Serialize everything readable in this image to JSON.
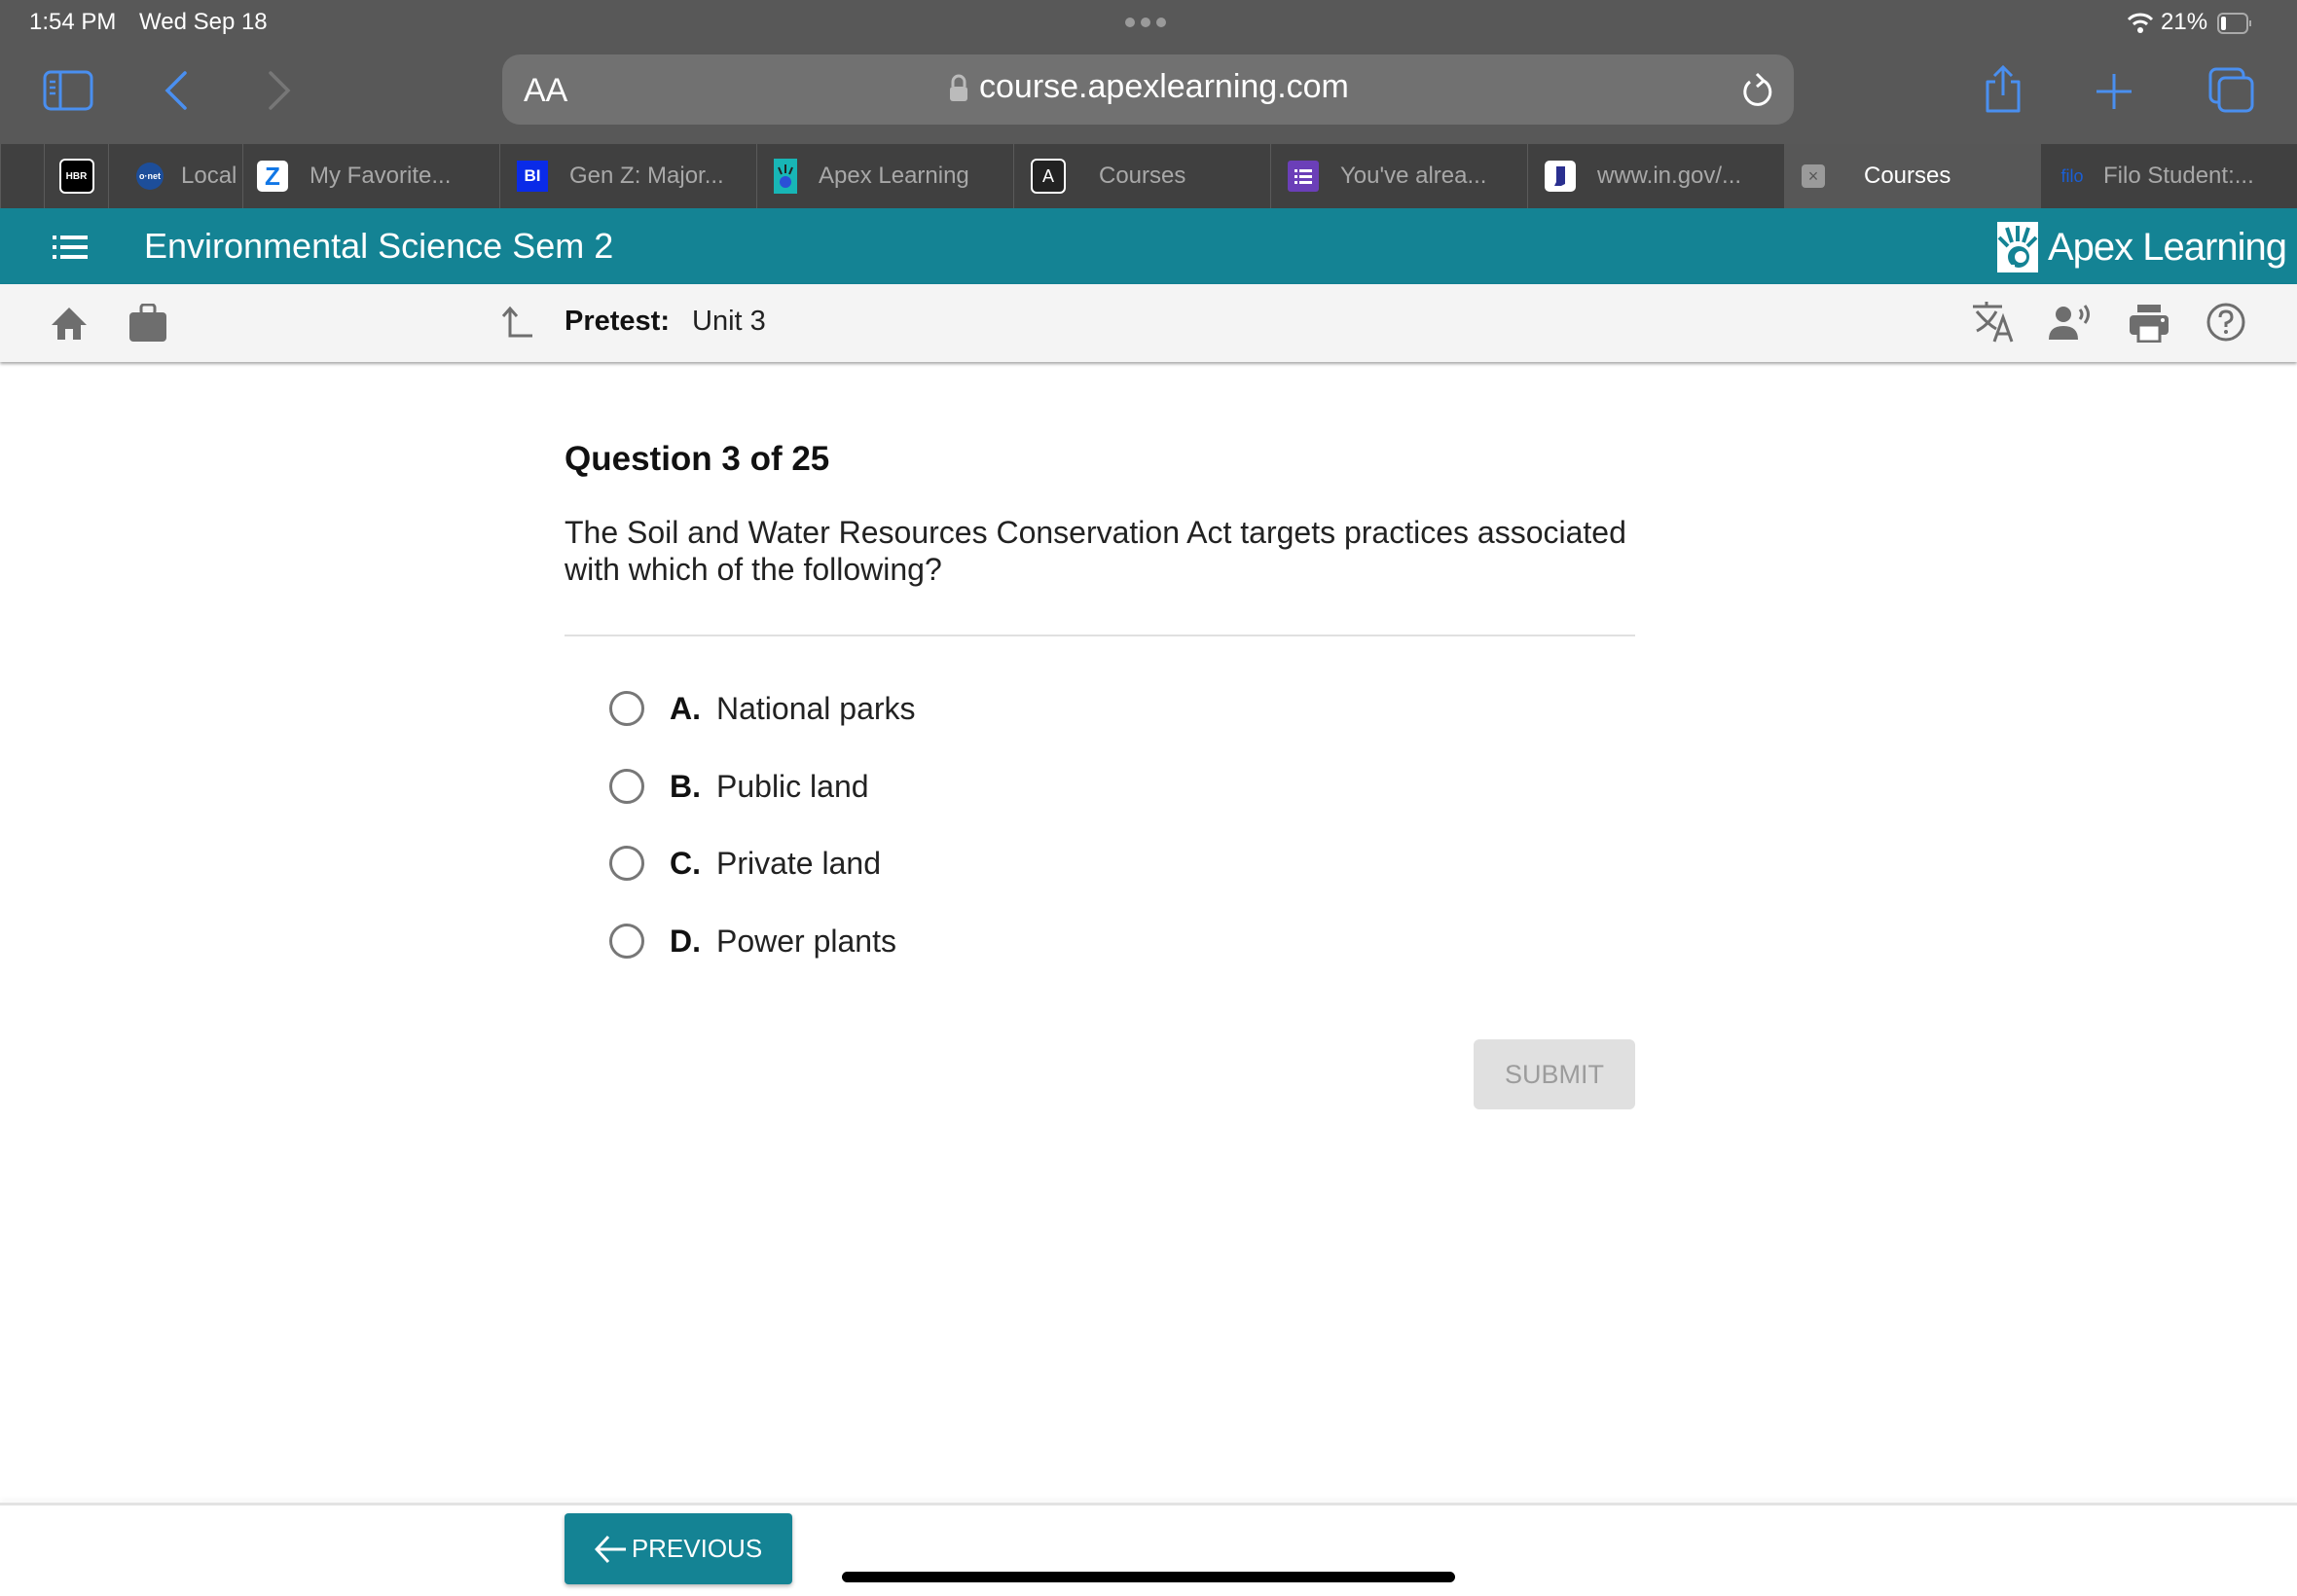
{
  "status_bar": {
    "time": "1:54 PM",
    "date": "Wed Sep 18",
    "battery": "21%"
  },
  "browser": {
    "text_size_label": "AA",
    "url": "course.apexlearning.com",
    "tabs": [
      {
        "label": "",
        "favicon": "hbr-icon"
      },
      {
        "label": "Local",
        "favicon": "onet-icon"
      },
      {
        "label": "My Favorite...",
        "favicon": "zillow-icon"
      },
      {
        "label": "Gen Z: Major...",
        "favicon": "bi-icon",
        "favicon_text": "BI"
      },
      {
        "label": "Apex Learning",
        "favicon": "apex-icon"
      },
      {
        "label": "Courses",
        "favicon": "a-icon",
        "favicon_text": "A"
      },
      {
        "label": "You've alrea...",
        "favicon": "forms-icon"
      },
      {
        "label": "www.in.gov/...",
        "favicon": "indiana-icon"
      },
      {
        "label": "Courses",
        "favicon": "close-tab-icon",
        "active": true
      },
      {
        "label": "Filo Student:...",
        "favicon": "filo-icon",
        "favicon_text": "filo"
      }
    ]
  },
  "app": {
    "course_title": "Environmental Science Sem 2",
    "brand": "Apex Learning",
    "brand_color": "#148394"
  },
  "subbar": {
    "activity_label": "Pretest:",
    "activity_value": "Unit 3"
  },
  "question": {
    "number_label": "Question 3 of 25",
    "text": "The Soil and Water Resources Conservation Act targets practices associated with which of the following?",
    "options": [
      {
        "letter": "A.",
        "text": "National parks"
      },
      {
        "letter": "B.",
        "text": "Public land"
      },
      {
        "letter": "C.",
        "text": "Private land"
      },
      {
        "letter": "D.",
        "text": "Power plants"
      }
    ],
    "submit_label": "SUBMIT"
  },
  "footer": {
    "previous_label": "PREVIOUS"
  }
}
